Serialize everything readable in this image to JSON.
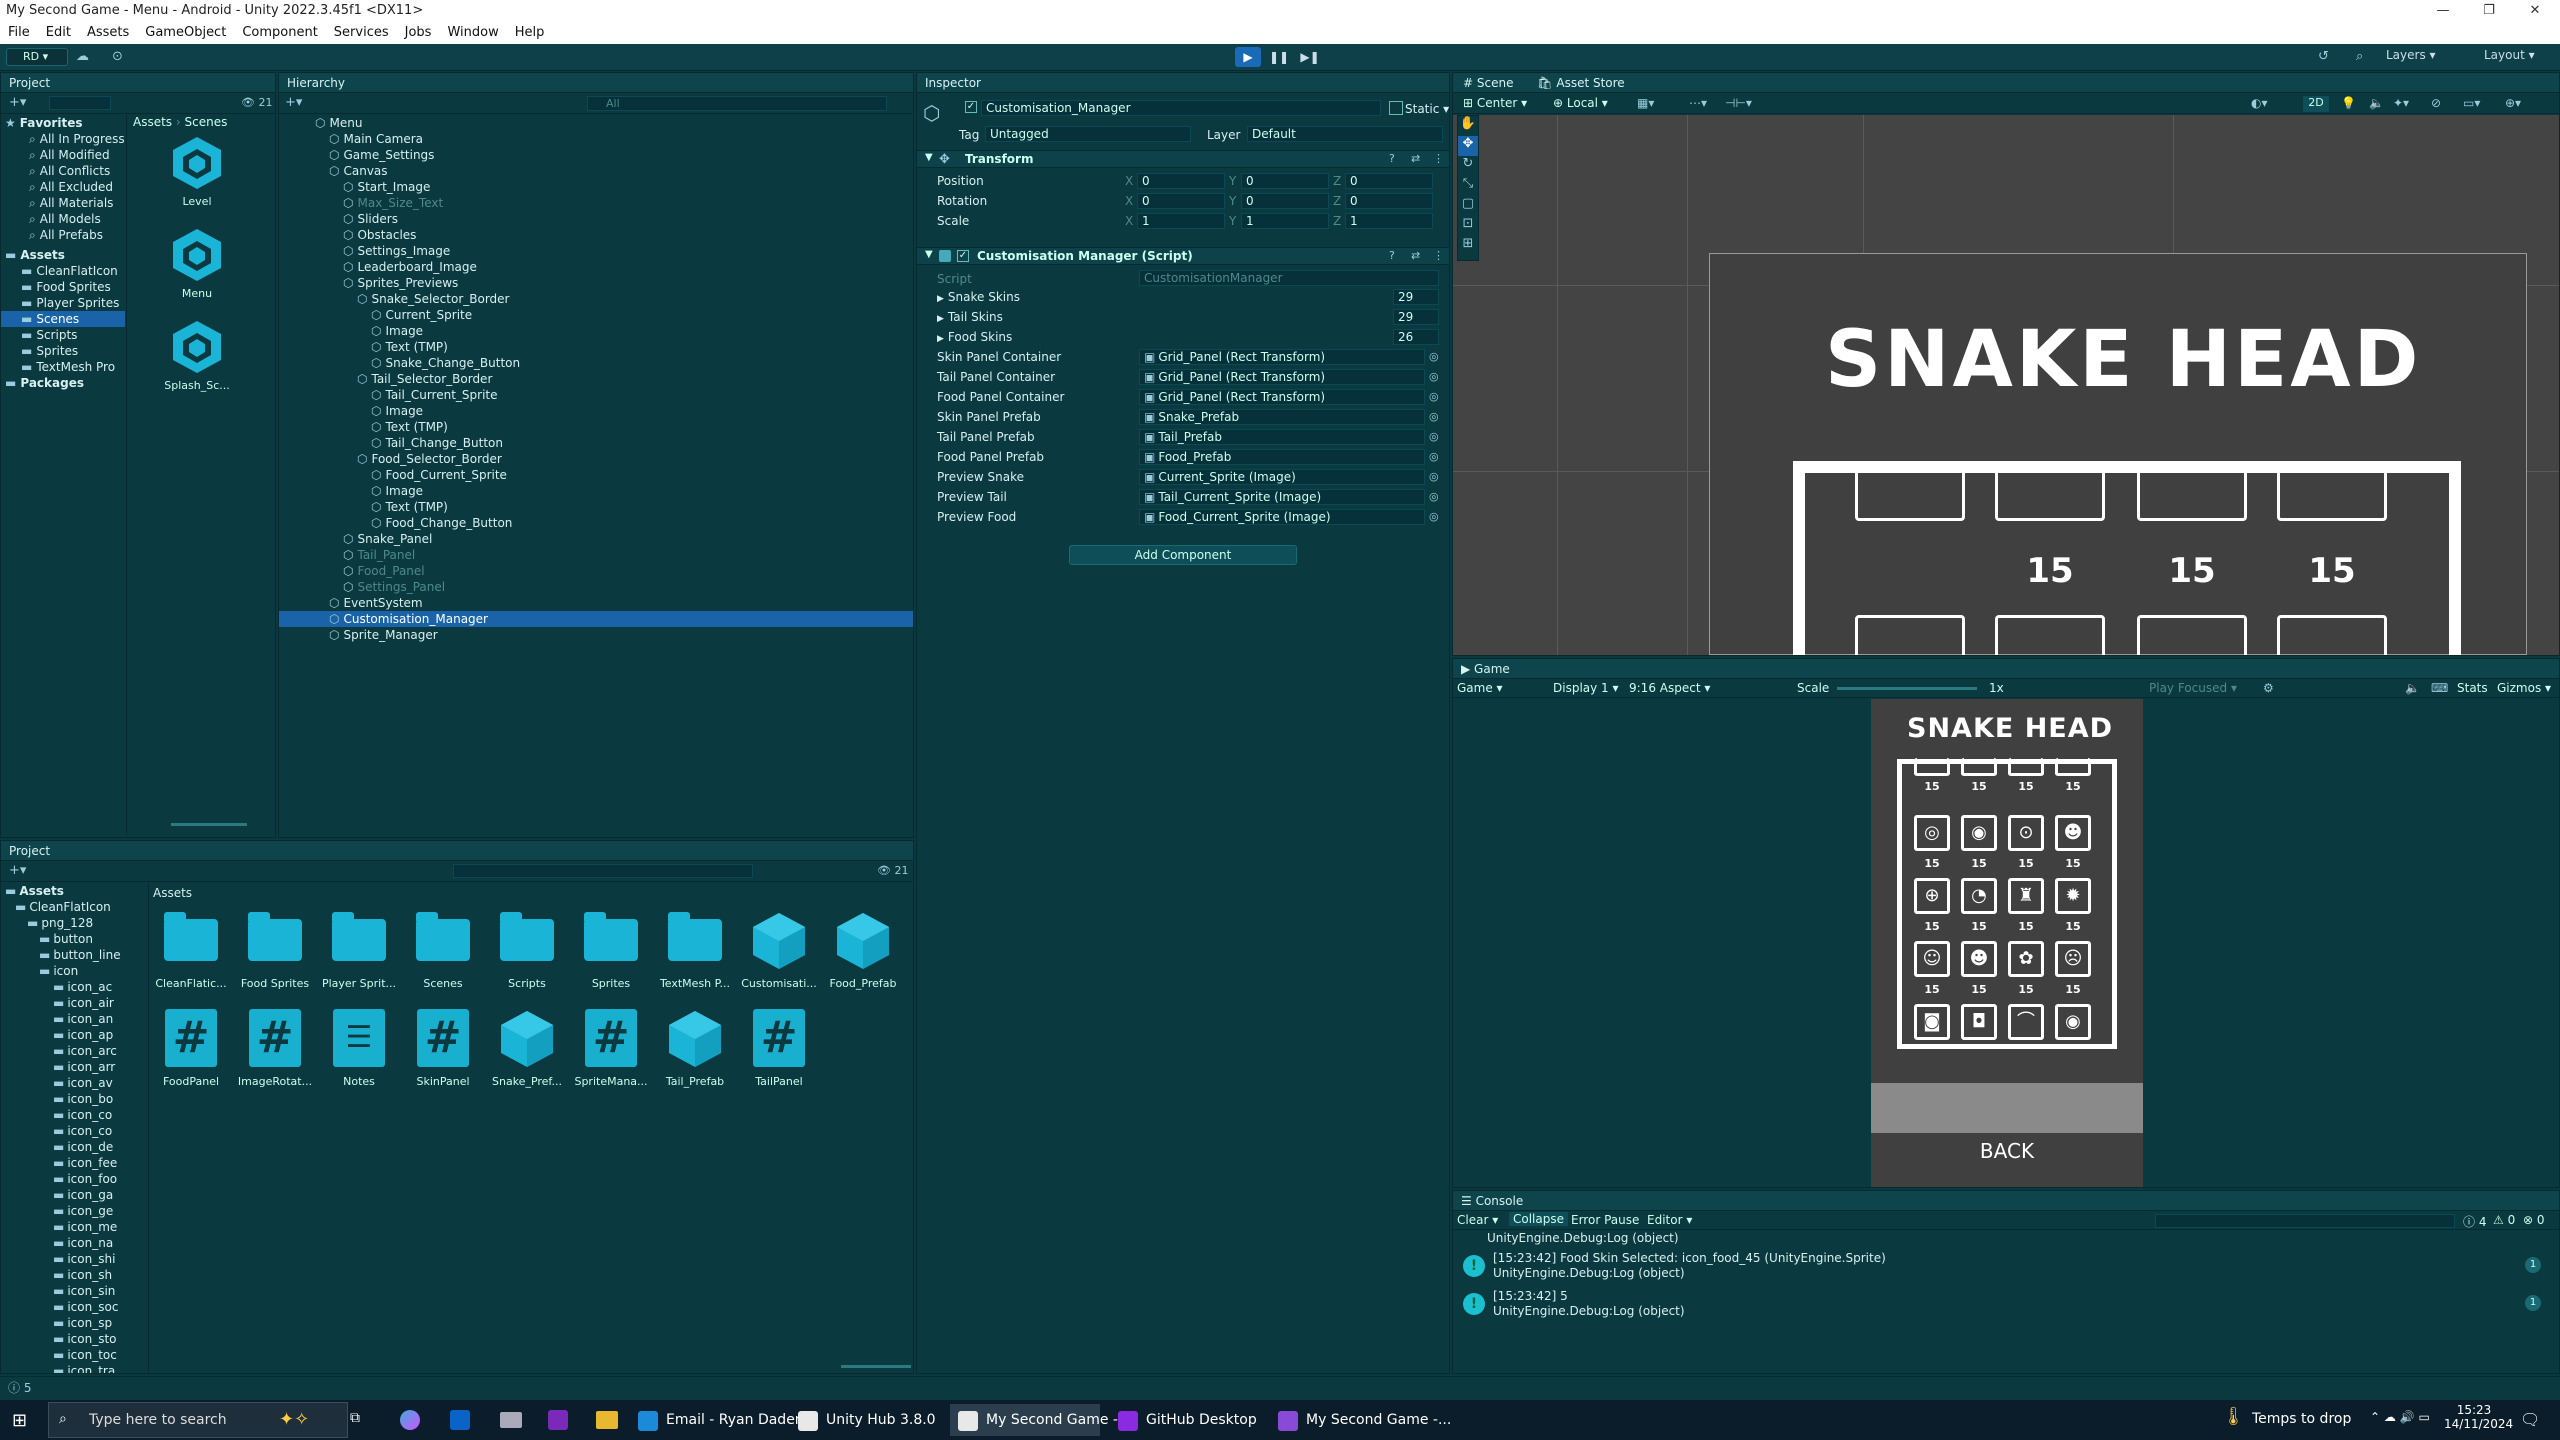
{
  "window": {
    "title": "My Second Game - Menu - Android - Unity 2022.3.45f1 <DX11>"
  },
  "menu": [
    "File",
    "Edit",
    "Assets",
    "GameObject",
    "Component",
    "Services",
    "Jobs",
    "Window",
    "Help"
  ],
  "toolbar": {
    "account": "RD",
    "layers": "Layers",
    "layout": "Layout"
  },
  "project_top": {
    "tab": "Project",
    "breadcrumb": [
      "Assets",
      "Scenes"
    ],
    "count": "21",
    "favorites_label": "Favorites",
    "favorites": [
      "All In Progress",
      "All Modified",
      "All Conflicts",
      "All Excluded",
      "All Materials",
      "All Models",
      "All Prefabs"
    ],
    "assets_label": "Assets",
    "assets": [
      "CleanFlatIcon",
      "Food Sprites",
      "Player Sprites",
      "Scenes",
      "Scripts",
      "Sprites",
      "TextMesh Pro"
    ],
    "packages_label": "Packages",
    "scenes": [
      "Level",
      "Menu",
      "Splash_Sc..."
    ]
  },
  "hierarchy": {
    "tab": "Hierarchy",
    "search": "All",
    "items": [
      "Menu",
      "Main Camera",
      "Game_Settings",
      "Canvas",
      "Start_Image",
      "Max_Size_Text",
      "Sliders",
      "Obstacles",
      "Settings_Image",
      "Leaderboard_Image",
      "Sprites_Previews",
      "Snake_Selector_Border",
      "Current_Sprite",
      "Image",
      "Text (TMP)",
      "Snake_Change_Button",
      "Tail_Selector_Border",
      "Tail_Current_Sprite",
      "Image",
      "Text (TMP)",
      "Tail_Change_Button",
      "Food_Selector_Border",
      "Food_Current_Sprite",
      "Image",
      "Text (TMP)",
      "Food_Change_Button",
      "Snake_Panel",
      "Tail_Panel",
      "Food_Panel",
      "Settings_Panel",
      "EventSystem",
      "Customisation_Manager",
      "Sprite_Manager"
    ]
  },
  "inspector": {
    "tab": "Inspector",
    "object_name": "Customisation_Manager",
    "static_label": "Static",
    "tag_label": "Tag",
    "tag_value": "Untagged",
    "layer_label": "Layer",
    "layer_value": "Default",
    "transform": {
      "title": "Transform",
      "position_label": "Position",
      "rotation_label": "Rotation",
      "scale_label": "Scale",
      "axis_x": "X",
      "axis_y": "Y",
      "axis_z": "Z",
      "position": [
        "0",
        "0",
        "0"
      ],
      "rotation": [
        "0",
        "0",
        "0"
      ],
      "scale": [
        "1",
        "1",
        "1"
      ]
    },
    "script": {
      "title": "Customisation Manager (Script)",
      "script_label": "Script",
      "script_value": "CustomisationManager"
    },
    "props": [
      {
        "label": "Snake Skins",
        "value": "29"
      },
      {
        "label": "Tail Skins",
        "value": "29"
      },
      {
        "label": "Food Skins",
        "value": "26"
      },
      {
        "label": "Skin Panel Container",
        "value": "Grid_Panel (Rect Transform)"
      },
      {
        "label": "Tail Panel Container",
        "value": "Grid_Panel (Rect Transform)"
      },
      {
        "label": "Food Panel Container",
        "value": "Grid_Panel (Rect Transform)"
      },
      {
        "label": "Skin Panel Prefab",
        "value": "Snake_Prefab"
      },
      {
        "label": "Tail Panel Prefab",
        "value": "Tail_Prefab"
      },
      {
        "label": "Food Panel Prefab",
        "value": "Food_Prefab"
      },
      {
        "label": "Preview Snake",
        "value": "Current_Sprite (Image)"
      },
      {
        "label": "Preview Tail",
        "value": "Tail_Current_Sprite (Image)"
      },
      {
        "label": "Preview Food",
        "value": "Food_Current_Sprite (Image)"
      }
    ],
    "add_component": "Add Component"
  },
  "scene": {
    "tab": "Scene",
    "tab2": "Asset Store",
    "pivot": "Center",
    "space": "Local",
    "mode2d": "2D",
    "title": "SNAKE HEAD",
    "nums": [
      "15",
      "15",
      "15"
    ]
  },
  "game": {
    "tab": "Game",
    "view": "Game",
    "display": "Display 1",
    "aspect": "9:16 Aspect",
    "scale_label": "Scale",
    "scale_value": "1x",
    "play_focused": "Play Focused",
    "stats": "Stats",
    "gizmos": "Gizmos",
    "title": "SNAKE HEAD",
    "back": "BACK",
    "price": "15"
  },
  "project_bottom": {
    "tab": "Project",
    "count": "21",
    "breadcrumb": "Assets",
    "tree": [
      "Assets",
      "CleanFlatIcon",
      "png_128",
      "button",
      "button_line",
      "icon",
      "icon_ac",
      "icon_air",
      "icon_an",
      "icon_ap",
      "icon_arc",
      "icon_arr",
      "icon_av",
      "icon_bo",
      "icon_co",
      "icon_co",
      "icon_de",
      "icon_fee",
      "icon_foo",
      "icon_ga",
      "icon_ge",
      "icon_me",
      "icon_na",
      "icon_shi",
      "icon_sh",
      "icon_sin",
      "icon_soc",
      "icon_sp",
      "icon_sto",
      "icon_toc",
      "icon_tra"
    ],
    "assets": [
      {
        "name": "CleanFlatic...",
        "kind": "folder"
      },
      {
        "name": "Food Sprites",
        "kind": "folder"
      },
      {
        "name": "Player Sprit...",
        "kind": "folder"
      },
      {
        "name": "Scenes",
        "kind": "folder"
      },
      {
        "name": "Scripts",
        "kind": "folder"
      },
      {
        "name": "Sprites",
        "kind": "folder"
      },
      {
        "name": "TextMesh P...",
        "kind": "folder"
      },
      {
        "name": "Customisati...",
        "kind": "prefab"
      },
      {
        "name": "Food_Prefab",
        "kind": "prefab"
      },
      {
        "name": "FoodPanel",
        "kind": "script"
      },
      {
        "name": "ImageRotat...",
        "kind": "script"
      },
      {
        "name": "Notes",
        "kind": "text"
      },
      {
        "name": "SkinPanel",
        "kind": "script"
      },
      {
        "name": "Snake_Pref...",
        "kind": "prefab"
      },
      {
        "name": "SpriteMana...",
        "kind": "script"
      },
      {
        "name": "Tail_Prefab",
        "kind": "prefab"
      },
      {
        "name": "TailPanel",
        "kind": "script"
      }
    ]
  },
  "console": {
    "tab": "Console",
    "clear": "Clear",
    "collapse": "Collapse",
    "error_pause": "Error Pause",
    "editor": "Editor",
    "counts": [
      "4",
      "0",
      "0"
    ],
    "partial": "UnityEngine.Debug:Log (object)",
    "messages": [
      {
        "line1": "[15:23:42] Food Skin Selected: icon_food_45 (UnityEngine.Sprite)",
        "line2": "UnityEngine.Debug:Log (object)",
        "count": "1"
      },
      {
        "line1": "[15:23:42] 5",
        "line2": "UnityEngine.Debug:Log (object)",
        "count": "1"
      }
    ]
  },
  "statusbar": {
    "count": "5"
  },
  "taskbar": {
    "search": "Type here to search",
    "apps": [
      "Email - Ryan Daden...",
      "Unity Hub 3.8.0",
      "My Second Game -...",
      "GitHub Desktop",
      "My Second Game -..."
    ],
    "tray": "Temps to drop",
    "time": "15:23",
    "date": "14/11/2024"
  }
}
